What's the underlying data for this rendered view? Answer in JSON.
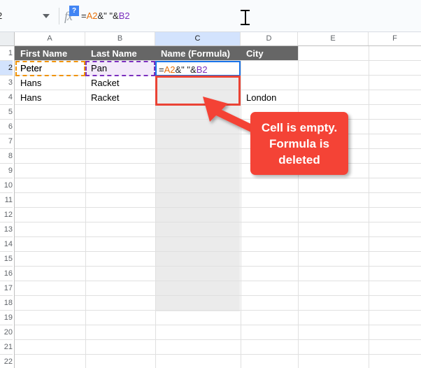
{
  "formula_bar": {
    "name_box_value": "2",
    "name_box_caret_icon": "chevron-down-icon",
    "fx_icon": "fx-icon",
    "help_badge_label": "?",
    "formula_parts": {
      "eq": "=",
      "ref_a": "A2",
      "amp1": "&",
      "quoted_space": "\" \"",
      "amp2": "&",
      "ref_b": "B2"
    },
    "formula_full": "=A2&\" \"&B2",
    "mouse_cursor_icon": "text-ibeam-cursor"
  },
  "spreadsheet": {
    "column_headers": [
      "A",
      "B",
      "C",
      "D",
      "E",
      "F"
    ],
    "selected_column": "C",
    "selected_row": "2",
    "row_numbers": [
      "1",
      "2",
      "3",
      "4",
      "5",
      "6",
      "7",
      "8",
      "9",
      "10",
      "11",
      "12",
      "13",
      "14",
      "15",
      "16",
      "17",
      "18",
      "19",
      "20",
      "21",
      "22"
    ],
    "header_row": {
      "A": "First Name",
      "B": "Last Name",
      "C": "Name (Formula)",
      "D": "City"
    },
    "rows": [
      {
        "row": "2",
        "A": "Peter",
        "B": "Pan",
        "C": "=A2&\" \"&B2",
        "D": ""
      },
      {
        "row": "3",
        "A": "Hans",
        "B": "Racket",
        "C": "",
        "D": ""
      },
      {
        "row": "4",
        "A": "Hans",
        "B": "Racket",
        "C": "",
        "D": "London"
      }
    ],
    "active_cell": "C2",
    "highlighted_empty_cell": "C3",
    "reference_highlight_a": "A2",
    "reference_highlight_b": "B2"
  },
  "callout": {
    "text": "Cell is empty. Formula is deleted",
    "line1": "Cell is empty.",
    "line2": "Formula is",
    "line3": "deleted",
    "arrow_icon": "arrow-up-left-icon",
    "color": "#f44336"
  },
  "colors": {
    "accent_blue": "#1a73e8",
    "selected_header": "#d3e3fd",
    "table_header_bg": "#666666",
    "ref_orange": "#f09300",
    "ref_purple": "#7b2fbe",
    "callout_red": "#f44336",
    "empty_cell_border": "#ea4335"
  }
}
